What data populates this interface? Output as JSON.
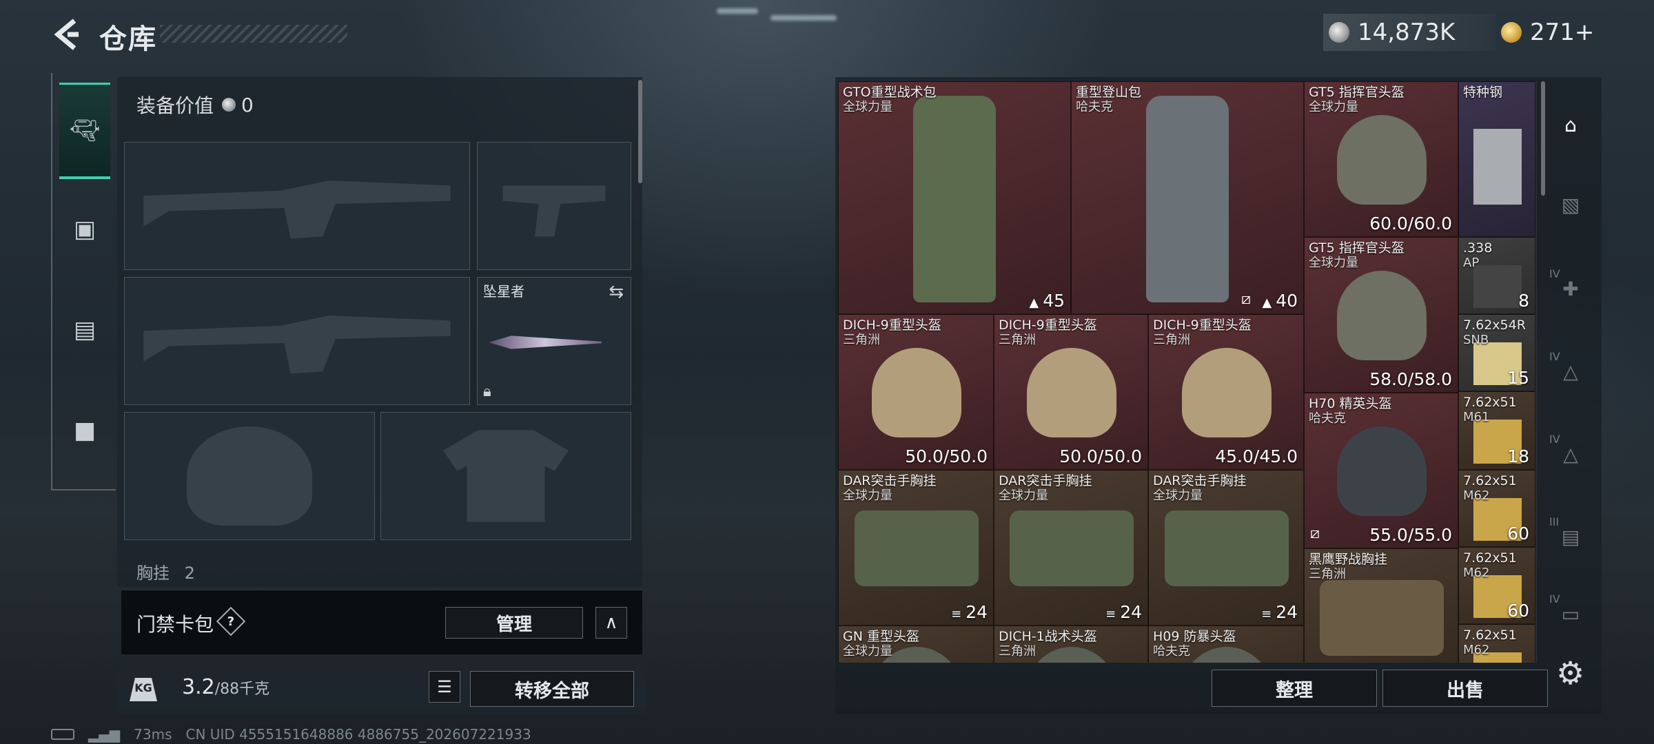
{
  "header": {
    "title": "仓库"
  },
  "currency": {
    "silver": "14,873K",
    "gold": "271+"
  },
  "equipment": {
    "value_label": "装备价值",
    "value": "0",
    "melee_name": "坠星者",
    "chest_label": "胸挂",
    "chest_count": "2"
  },
  "keycard": {
    "label": "门禁卡包",
    "help": "?",
    "manage": "管理"
  },
  "capacity": {
    "current": "3.2",
    "max": "/88千克",
    "weight_icon_text": "KG",
    "transfer_all": "转移全部"
  },
  "status": {
    "ping": "73ms",
    "uid": "CN UID 4555151648886 4886755_202607221933"
  },
  "stash_items": [
    {
      "name": "GTO重型战术包",
      "org": "全球力量",
      "stat": "45",
      "stat_icon": "backpack-capacity-icon"
    },
    {
      "name": "重型登山包",
      "org": "哈夫克",
      "stat": "40",
      "stat_icon": "backpack-capacity-icon"
    },
    {
      "name": "GT5 指挥官头盔",
      "org": "全球力量",
      "stat": "60.0/60.0"
    },
    {
      "name": "特种钢",
      "org": "",
      "stat": ""
    },
    {
      "name": "GT5 指挥官头盔",
      "org": "全球力量",
      "stat": "58.0/58.0"
    },
    {
      "name": ".338",
      "org": "AP",
      "stat": "8"
    },
    {
      "name": "DICH-9重型头盔",
      "org": "三角洲",
      "stat": "50.0/50.0"
    },
    {
      "name": "DICH-9重型头盔",
      "org": "三角洲",
      "stat": "50.0/50.0"
    },
    {
      "name": "DICH-9重型头盔",
      "org": "三角洲",
      "stat": "45.0/45.0"
    },
    {
      "name": "7.62x54R",
      "org": "SNB",
      "stat": "15"
    },
    {
      "name": "H70 精英头盔",
      "org": "哈夫克",
      "stat": "55.0/55.0"
    },
    {
      "name": "7.62x51",
      "org": "M61",
      "stat": "18"
    },
    {
      "name": "DAR突击手胸挂",
      "org": "全球力量",
      "stat": "24",
      "stat_icon": "vest-capacity-icon"
    },
    {
      "name": "DAR突击手胸挂",
      "org": "全球力量",
      "stat": "24",
      "stat_icon": "vest-capacity-icon"
    },
    {
      "name": "DAR突击手胸挂",
      "org": "全球力量",
      "stat": "24",
      "stat_icon": "vest-capacity-icon"
    },
    {
      "name": "7.62x51",
      "org": "M62",
      "stat": "60"
    },
    {
      "name": "黑鹰野战胸挂",
      "org": "三角洲",
      "stat": ""
    },
    {
      "name": "7.62x51",
      "org": "M62",
      "stat": "60"
    },
    {
      "name": "GN 重型头盔",
      "org": "全球力量",
      "stat": ""
    },
    {
      "name": "DICH-1战术头盔",
      "org": "三角洲",
      "stat": ""
    },
    {
      "name": "H09 防暴头盔",
      "org": "哈夫克",
      "stat": ""
    },
    {
      "name": "7.62x51",
      "org": "M62",
      "stat": ""
    }
  ],
  "stash_rail": {
    "tier4": "IV",
    "tier3": "III"
  },
  "buttons": {
    "sort": "整理",
    "sell": "出售"
  },
  "colors": {
    "accent": "#3fd0b2",
    "rarity_red": "#5a3034",
    "rarity_purple": "#3d3550",
    "rarity_brown": "#4b3c30"
  }
}
